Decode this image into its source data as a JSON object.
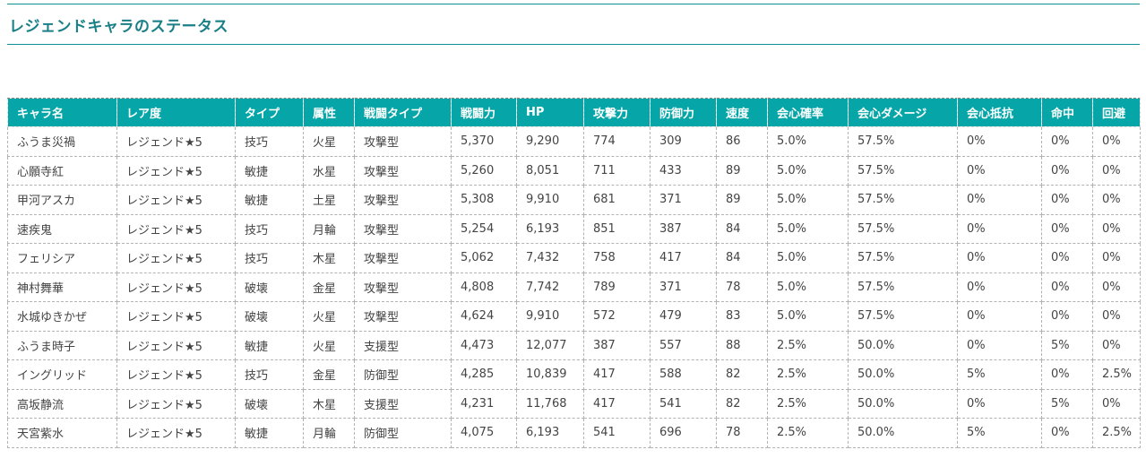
{
  "page": {
    "title": "レジェンドキャラのステータス"
  },
  "table": {
    "headers": [
      "キャラ名",
      "レア度",
      "タイプ",
      "属性",
      "戦闘タイプ",
      "戦闘力",
      "HP",
      "攻撃力",
      "防御力",
      "速度",
      "会心確率",
      "会心ダメージ",
      "会心抵抗",
      "命中",
      "回避"
    ],
    "rows": [
      [
        "ふうま災禍",
        "レジェンド★5",
        "技巧",
        "火星",
        "攻撃型",
        "5,370",
        "9,290",
        "774",
        "309",
        "86",
        "5.0%",
        "57.5%",
        "0%",
        "0%",
        "0%"
      ],
      [
        "心願寺紅",
        "レジェンド★5",
        "敏捷",
        "水星",
        "攻撃型",
        "5,260",
        "8,051",
        "711",
        "433",
        "89",
        "5.0%",
        "57.5%",
        "0%",
        "0%",
        "0%"
      ],
      [
        "甲河アスカ",
        "レジェンド★5",
        "敏捷",
        "土星",
        "攻撃型",
        "5,308",
        "9,910",
        "681",
        "371",
        "89",
        "5.0%",
        "57.5%",
        "0%",
        "0%",
        "0%"
      ],
      [
        "速疾鬼",
        "レジェンド★5",
        "技巧",
        "月輪",
        "攻撃型",
        "5,254",
        "6,193",
        "851",
        "387",
        "84",
        "5.0%",
        "57.5%",
        "0%",
        "0%",
        "0%"
      ],
      [
        "フェリシア",
        "レジェンド★5",
        "技巧",
        "木星",
        "攻撃型",
        "5,062",
        "7,432",
        "758",
        "417",
        "84",
        "5.0%",
        "57.5%",
        "0%",
        "0%",
        "0%"
      ],
      [
        "神村舞華",
        "レジェンド★5",
        "破壊",
        "金星",
        "攻撃型",
        "4,808",
        "7,742",
        "789",
        "371",
        "78",
        "5.0%",
        "57.5%",
        "0%",
        "0%",
        "0%"
      ],
      [
        "水城ゆきかぜ",
        "レジェンド★5",
        "破壊",
        "火星",
        "攻撃型",
        "4,624",
        "9,910",
        "572",
        "479",
        "83",
        "5.0%",
        "57.5%",
        "0%",
        "0%",
        "0%"
      ],
      [
        "ふうま時子",
        "レジェンド★5",
        "敏捷",
        "火星",
        "支援型",
        "4,473",
        "12,077",
        "387",
        "557",
        "88",
        "2.5%",
        "50.0%",
        "0%",
        "5%",
        "0%"
      ],
      [
        "イングリッド",
        "レジェンド★5",
        "技巧",
        "金星",
        "防御型",
        "4,285",
        "10,839",
        "417",
        "588",
        "82",
        "2.5%",
        "50.0%",
        "5%",
        "0%",
        "2.5%"
      ],
      [
        "高坂静流",
        "レジェンド★5",
        "破壊",
        "木星",
        "支援型",
        "4,231",
        "11,768",
        "417",
        "541",
        "82",
        "2.5%",
        "50.0%",
        "0%",
        "5%",
        "0%"
      ],
      [
        "天宮紫水",
        "レジェンド★5",
        "敏捷",
        "月輪",
        "防御型",
        "4,075",
        "6,193",
        "541",
        "696",
        "78",
        "2.5%",
        "50.0%",
        "5%",
        "0%",
        "2.5%"
      ]
    ]
  },
  "colors": {
    "header_bg": "#06a6a8",
    "title_color": "#1a7f87",
    "rule_color": "#0e8f94"
  }
}
